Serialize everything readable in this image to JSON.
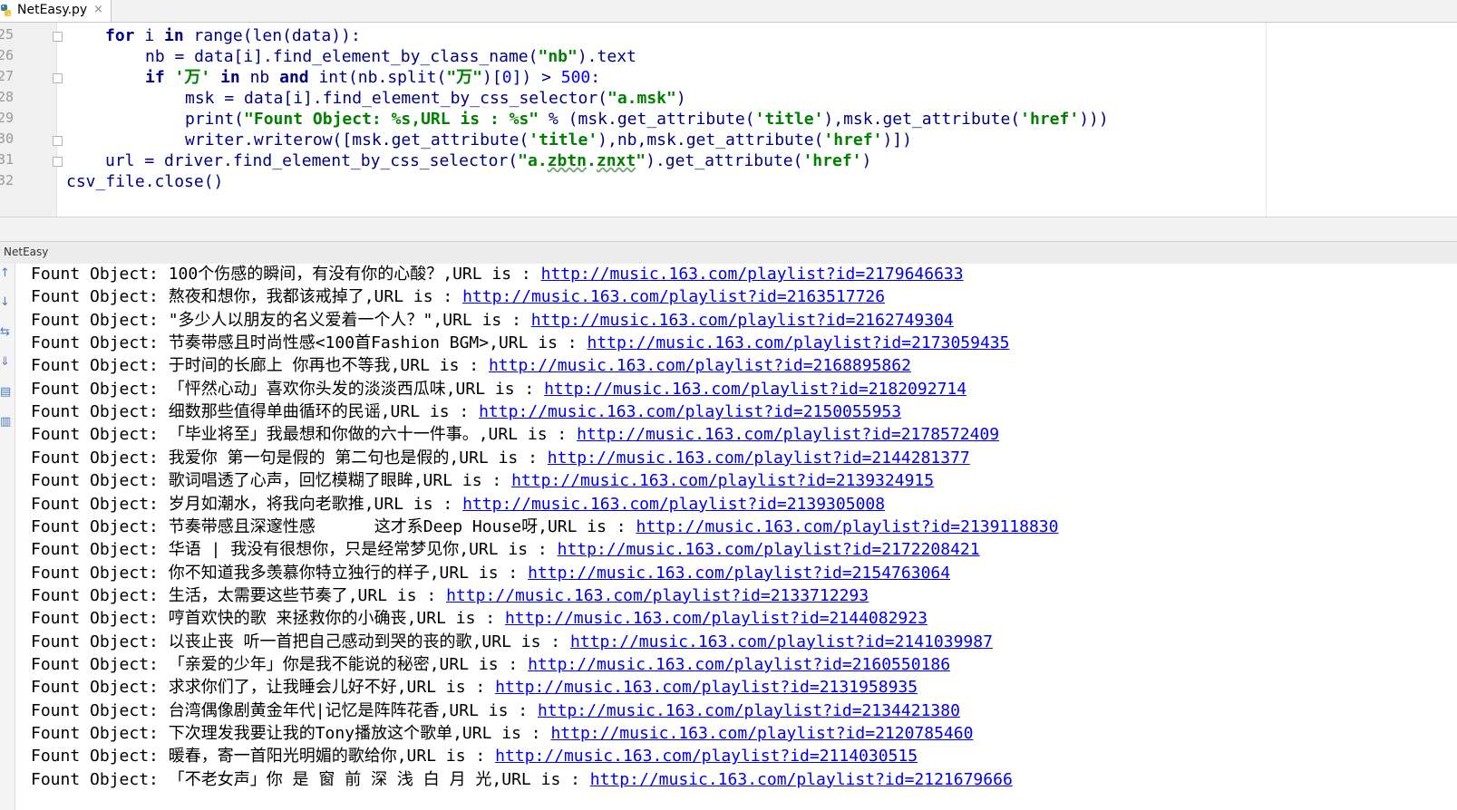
{
  "tab": {
    "filename": "NetEasy.py",
    "close_glyph": "×"
  },
  "editor": {
    "line_numbers": [
      "25",
      "26",
      "27",
      "28",
      "29",
      "30",
      "31",
      "32"
    ]
  },
  "run_panel": {
    "title": "NetEasy"
  },
  "console": {
    "prefix": "Fount Object: ",
    "url_sep": ",URL is : ",
    "lines": [
      {
        "title": "100个伤感的瞬间，有没有你的心酸？",
        "url": "http://music.163.com/playlist?id=2179646633"
      },
      {
        "title": "熬夜和想你，我都该戒掉了",
        "url": "http://music.163.com/playlist?id=2163517726"
      },
      {
        "title": "\"多少人以朋友的名义爱着一个人？\"",
        "url": "http://music.163.com/playlist?id=2162749304"
      },
      {
        "title": "节奏带感且时尚性感<100首Fashion BGM>",
        "url": "http://music.163.com/playlist?id=2173059435"
      },
      {
        "title": "于时间的长廊上 你再也不等我",
        "url": "http://music.163.com/playlist?id=2168895862"
      },
      {
        "title": "「怦然心动」喜欢你头发的淡淡西瓜味",
        "url": "http://music.163.com/playlist?id=2182092714"
      },
      {
        "title": "细数那些值得单曲循环的民谣",
        "url": "http://music.163.com/playlist?id=2150055953"
      },
      {
        "title": "「毕业将至」我最想和你做的六十一件事。",
        "url": "http://music.163.com/playlist?id=2178572409"
      },
      {
        "title": "我爱你 第一句是假的 第二句也是假的",
        "url": "http://music.163.com/playlist?id=2144281377"
      },
      {
        "title": "歌词唱透了心声，回忆模糊了眼眸",
        "url": "http://music.163.com/playlist?id=2139324915"
      },
      {
        "title": "岁月如潮水，将我向老歌推",
        "url": "http://music.163.com/playlist?id=2139305008"
      },
      {
        "title": "节奏带感且深邃性感      这才系Deep House呀",
        "url": "http://music.163.com/playlist?id=2139118830"
      },
      {
        "title": "华语 | 我没有很想你，只是经常梦见你",
        "url": "http://music.163.com/playlist?id=2172208421"
      },
      {
        "title": "你不知道我多羡慕你特立独行的样子",
        "url": "http://music.163.com/playlist?id=2154763064"
      },
      {
        "title": "生活，太需要这些节奏了",
        "url": "http://music.163.com/playlist?id=2133712293"
      },
      {
        "title": "哼首欢快的歌 来拯救你的小确丧",
        "url": "http://music.163.com/playlist?id=2144082923"
      },
      {
        "title": "以丧止丧 听一首把自己感动到哭的丧的歌",
        "url": "http://music.163.com/playlist?id=2141039987"
      },
      {
        "title": "「亲爱的少年」你是我不能说的秘密",
        "url": "http://music.163.com/playlist?id=2160550186"
      },
      {
        "title": "求求你们了，让我睡会儿好不好",
        "url": "http://music.163.com/playlist?id=2131958935"
      },
      {
        "title": "台湾偶像剧黄金年代|记忆是阵阵花香",
        "url": "http://music.163.com/playlist?id=2134421380"
      },
      {
        "title": "下次理发我要让我的Tony播放这个歌单",
        "url": "http://music.163.com/playlist?id=2120785460"
      },
      {
        "title": "暖春，寄一首阳光明媚的歌给你",
        "url": "http://music.163.com/playlist?id=2114030515"
      },
      {
        "title": "「不老女声」你 是 窗 前 深 浅 白 月 光",
        "url": "http://music.163.com/playlist?id=2121679666"
      }
    ]
  },
  "toolbar_icons": [
    "up-arrow-icon",
    "down-arrow-icon",
    "soft-wrap-icon",
    "scroll-to-end-icon",
    "print-icon",
    "trash-icon"
  ]
}
